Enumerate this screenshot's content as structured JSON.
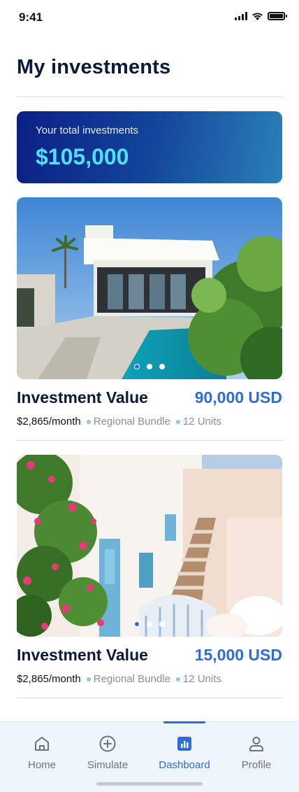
{
  "status_bar": {
    "time": "9:41"
  },
  "page": {
    "title": "My investments"
  },
  "total": {
    "label": "Your total investments",
    "amount": "$105,000"
  },
  "investments": [
    {
      "title": "Investment Value",
      "value": "90,000 USD",
      "monthly": "$2,865/month",
      "bundle": "Regional Bundle",
      "units": "12 Units",
      "active_slide": 1,
      "slides": 3
    },
    {
      "title": "Investment Value",
      "value": "15,000 USD",
      "monthly": "$2,865/month",
      "bundle": "Regional Bundle",
      "units": "12 Units",
      "active_slide": 1,
      "slides": 3
    }
  ],
  "nav": {
    "items": [
      {
        "label": "Home",
        "icon": "home-icon"
      },
      {
        "label": "Simulate",
        "icon": "plus-circle-icon"
      },
      {
        "label": "Dashboard",
        "icon": "bar-chart-icon",
        "active": true
      },
      {
        "label": "Profile",
        "icon": "user-icon"
      }
    ]
  },
  "colors": {
    "accent": "#2d6cdf",
    "title": "#0b1a3a",
    "amount": "#4fe0ff"
  }
}
